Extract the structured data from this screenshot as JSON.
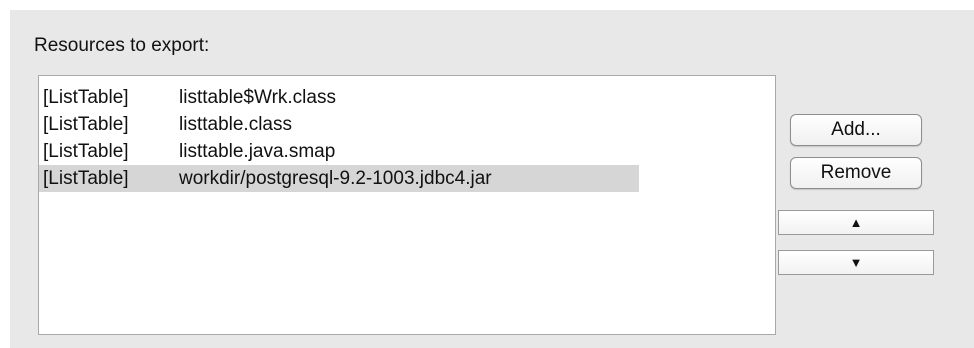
{
  "section": {
    "label": "Resources to export:"
  },
  "resources": [
    {
      "module": "[ListTable]",
      "path": "listtable$Wrk.class",
      "selected": false
    },
    {
      "module": "[ListTable]",
      "path": "listtable.class",
      "selected": false
    },
    {
      "module": "[ListTable]",
      "path": "listtable.java.smap",
      "selected": false
    },
    {
      "module": "[ListTable]",
      "path": "workdir/postgresql-9.2-1003.jdbc4.jar",
      "selected": true
    }
  ],
  "buttons": {
    "add_label": "Add...",
    "remove_label": "Remove",
    "move_up_label": "▲",
    "move_down_label": "▼"
  },
  "colors": {
    "panel_bg": "#e8e8e8",
    "selection_bg": "#d6d6d6"
  }
}
